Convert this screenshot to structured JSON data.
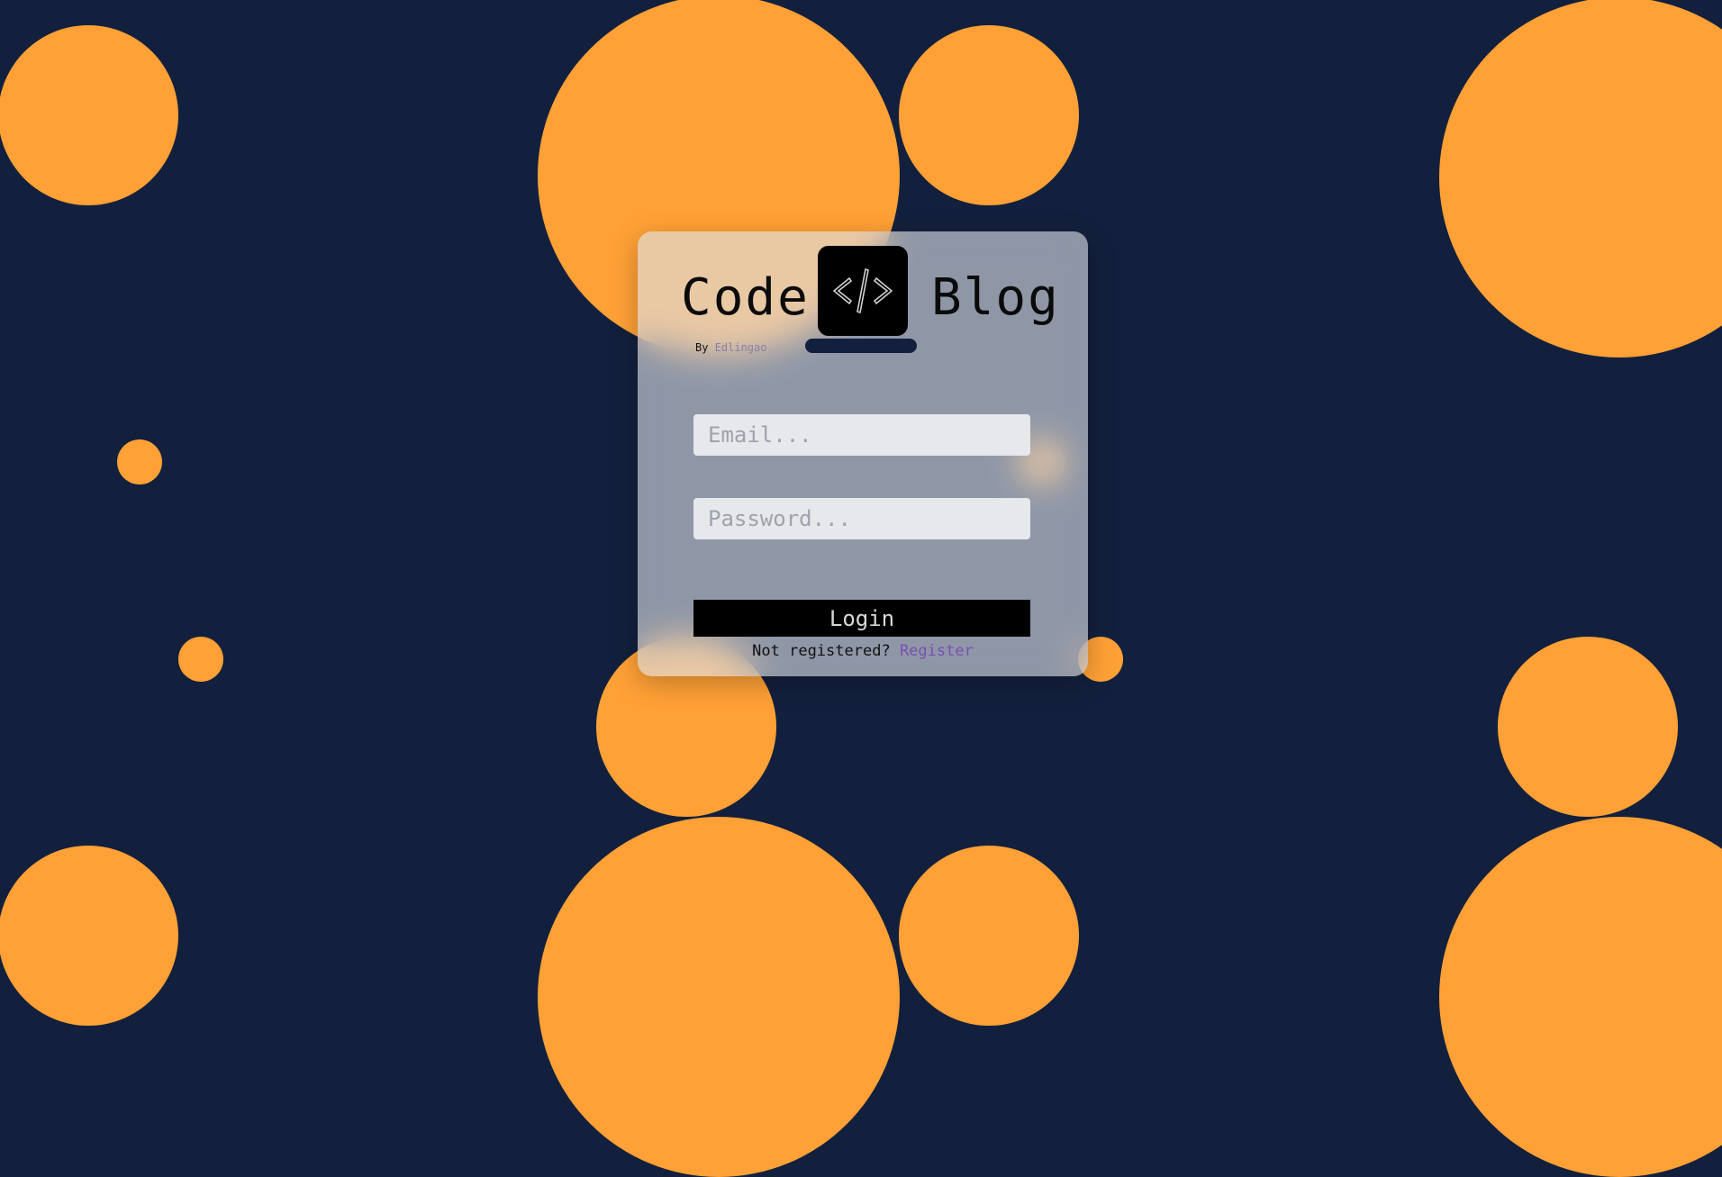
{
  "brand": {
    "word_left": "Code",
    "word_right": "Blog",
    "logo_glyph": "</>",
    "logo_icon": "code-icon",
    "byline_prefix": "By",
    "byline_author": "Edlingao"
  },
  "form": {
    "email_placeholder": "Email...",
    "password_placeholder": "Password...",
    "login_label": "Login",
    "register_prompt": "Not registered?",
    "register_link": "Register"
  },
  "colors": {
    "background": "#13203d",
    "accent_circles": "#ffa136",
    "button": "#000000",
    "link": "#7b4fb3"
  }
}
